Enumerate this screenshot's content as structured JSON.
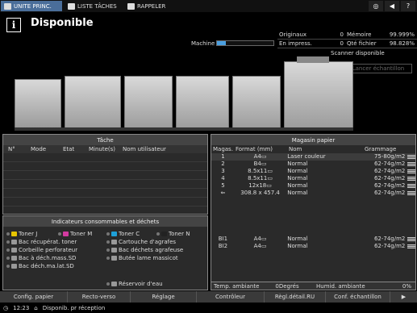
{
  "tabs": [
    {
      "label": "UNITE PRINC."
    },
    {
      "label": "LISTE TÂCHES"
    },
    {
      "label": "RAPPELER"
    }
  ],
  "status": {
    "title": "Disponible",
    "machine_label": "Machine",
    "machine_progress": 0.15
  },
  "counters": [
    {
      "label": "Originaux",
      "value": "0",
      "label2": "Mémoire",
      "value2": "99.999%"
    },
    {
      "label": "En impress.",
      "value": "0",
      "label2": "Qté fichier",
      "value2": "98.828%"
    }
  ],
  "scanner_status": "Scanner disponible",
  "sample_button": "Lancer échantillon",
  "task_panel": {
    "title": "Tâche",
    "columns": [
      "N°",
      "Mode",
      "Etat",
      "Minute(s)",
      "Nom utilisateur"
    ]
  },
  "consumables_panel": {
    "title": "Indicateurs consommables et déchets",
    "items": [
      {
        "label": "Toner J",
        "color": "#e6c400"
      },
      {
        "label": "Toner M",
        "color": "#d23aa0"
      },
      {
        "label": "Toner C",
        "color": "#1ea0d8"
      },
      {
        "label": "Toner N",
        "color": "#222222"
      },
      {
        "label": "Bac récupérat. toner"
      },
      {
        "label": "Cartouche d'agrafes"
      },
      {
        "label": "Corbeille perforateur"
      },
      {
        "label": "Bac déchets agrafeuse"
      },
      {
        "label": "Bac à déch.mass.SD"
      },
      {
        "label": "Butée lame massicot"
      },
      {
        "label": "Bac déch.ma.lat.SD"
      },
      {
        "label": "Réservoir d'eau"
      }
    ]
  },
  "paper_panel": {
    "title": "Magasin papier",
    "columns": [
      "Magas.",
      "Format (mm)",
      "Nom",
      "Grammage"
    ],
    "rows": [
      {
        "tray": "1",
        "format": "A4▭",
        "name": "Laser couleur",
        "weight": "75-80g/m2"
      },
      {
        "tray": "2",
        "format": "B4▭",
        "name": "Normal",
        "weight": "62-74g/m2"
      },
      {
        "tray": "3",
        "format": "8.5x11▭",
        "name": "Normal",
        "weight": "62-74g/m2"
      },
      {
        "tray": "4",
        "format": "8.5x11▭",
        "name": "Normal",
        "weight": "62-74g/m2"
      },
      {
        "tray": "5",
        "format": "12x18▭",
        "name": "Normal",
        "weight": "62-74g/m2"
      },
      {
        "tray": "⇐",
        "format": "308.8 x 457.4",
        "name": "Normal",
        "weight": "62-74g/m2"
      }
    ],
    "lower_rows": [
      {
        "tray": "BI1",
        "format": "A4▭",
        "name": "Normal",
        "weight": "62-74g/m2"
      },
      {
        "tray": "BI2",
        "format": "A4▭",
        "name": "Normal",
        "weight": "62-74g/m2"
      }
    ],
    "ambient_temp_label": "Temp. ambiante",
    "ambient_temp_value": "0Degrés",
    "ambient_humid_label": "Humid. ambiante",
    "ambient_humid_value": "0%"
  },
  "bottom_buttons": [
    {
      "label": "Config. papier"
    },
    {
      "label": "Recto-verso"
    },
    {
      "label": "Réglage"
    },
    {
      "label": "Contrôleur"
    },
    {
      "label": "Règl.détail.RU"
    },
    {
      "label": "Conf. échantillon"
    }
  ],
  "footer": {
    "time": "12:23",
    "status": "Disponib. pr réception"
  }
}
